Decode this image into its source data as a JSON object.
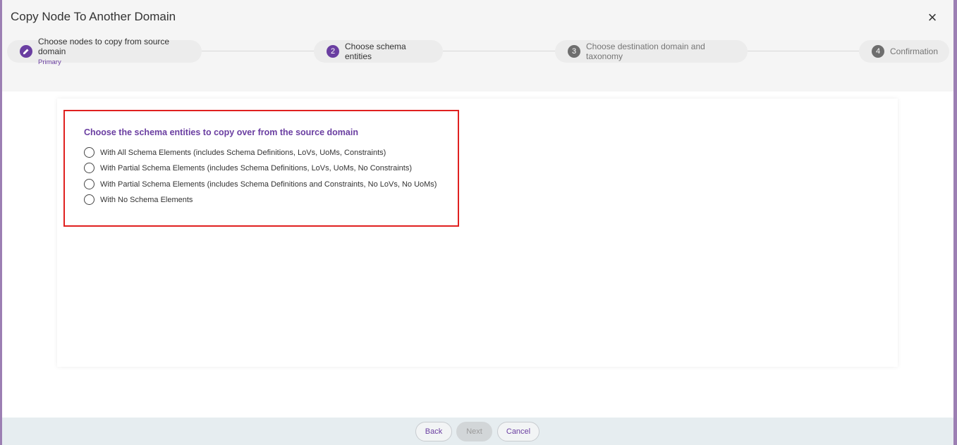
{
  "dialog": {
    "title": "Copy Node To Another Domain",
    "close_label": "×"
  },
  "stepper": {
    "steps": [
      {
        "number": "1",
        "icon": "pencil-icon",
        "label": "Choose nodes to copy from source domain",
        "sublabel": "Primary",
        "state": "completed"
      },
      {
        "number": "2",
        "label": "Choose schema entities",
        "state": "active"
      },
      {
        "number": "3",
        "label": "Choose destination domain and taxonomy",
        "state": "pending"
      },
      {
        "number": "4",
        "label": "Confirmation",
        "state": "pending"
      }
    ]
  },
  "schema_section": {
    "title": "Choose the schema entities to copy over from the source domain",
    "options": [
      {
        "label": "With All Schema Elements (includes Schema Definitions, LoVs, UoMs, Constraints)",
        "selected": false
      },
      {
        "label": "With Partial Schema Elements (includes Schema Definitions, LoVs, UoMs, No Constraints)",
        "selected": false
      },
      {
        "label": "With Partial Schema Elements (includes Schema Definitions and Constraints, No LoVs, No UoMs)",
        "selected": false
      },
      {
        "label": "With No Schema Elements",
        "selected": false
      }
    ]
  },
  "footer": {
    "back_label": "Back",
    "next_label": "Next",
    "cancel_label": "Cancel"
  },
  "colors": {
    "accent": "#6a3ea1",
    "highlight": "#e0201f",
    "footer_bg": "#e6edf0"
  }
}
